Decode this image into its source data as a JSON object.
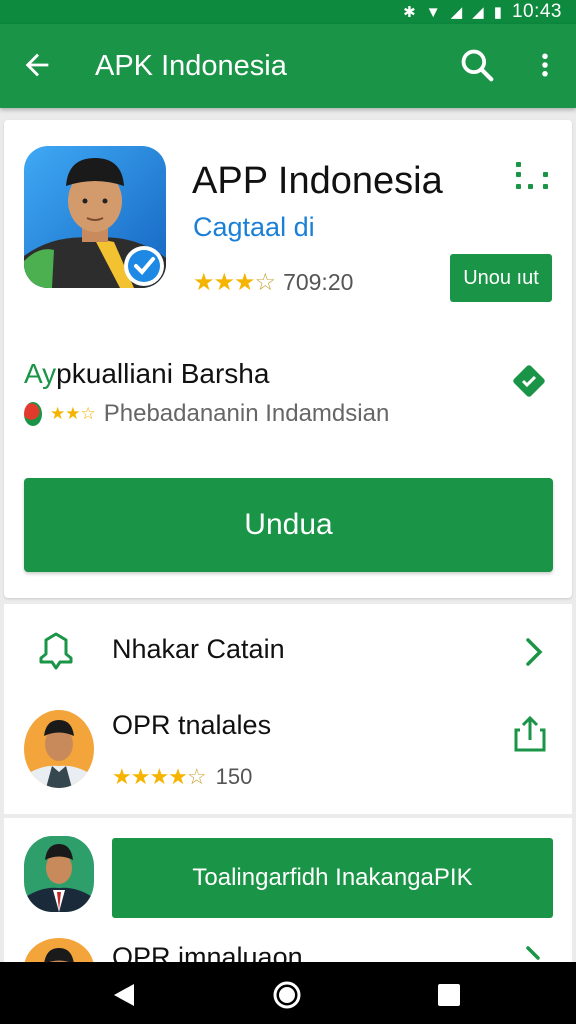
{
  "status_bar": {
    "time": "10:43",
    "icons": [
      "notification-icon",
      "wifi-icon",
      "signal-icon",
      "signal-icon",
      "battery-icon"
    ]
  },
  "app_bar": {
    "title": "APK Indonesia",
    "icons": [
      "back-arrow-icon",
      "search-icon",
      "more-vert-icon"
    ]
  },
  "app": {
    "name": "APP Indonesia",
    "developer": "Cagtaal di",
    "rating_stars": 3.5,
    "rating_text": "709:20",
    "action_label": "Unou ıut"
  },
  "section": {
    "title_prefix": "Ay",
    "title_rest": "pkualliani Barsha",
    "subtitle": "Phebadananin Indamdsian"
  },
  "download_label": "Undua",
  "list": [
    {
      "label": "Nhakar Catain"
    },
    {
      "label": "OPR tnalales",
      "rating_stars": 3.5,
      "rating_text": "150"
    }
  ],
  "promo_button": "Toalingarfidh InakangaPIK",
  "partial_row": {
    "label": "OPR imnaluaon"
  },
  "colors": {
    "primary": "#1a9446",
    "status_bar": "#0d8a3e",
    "link": "#1a7fd6",
    "star": "#f5b400"
  }
}
